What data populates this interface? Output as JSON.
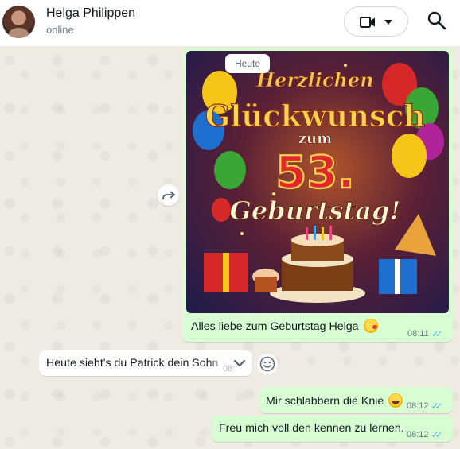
{
  "header": {
    "contact_name": "Helga Philippen",
    "status": "online"
  },
  "chat": {
    "date_chip": "Heute",
    "image_message": {
      "image_text_lines": [
        "Herzlichen",
        "Glückwunsch",
        "zum",
        "53.",
        "Geburtstag!"
      ],
      "caption": "Alles liebe zum Geburtstag Helga",
      "caption_emoji": "face-blowing-kiss",
      "time": "08:11",
      "status": "read"
    },
    "incoming_message": {
      "text": "Heute sieht's du Patrick dein Sohn",
      "time": "08:"
    },
    "outgoing_messages": [
      {
        "text": "Mir schlabbern die Knie",
        "emoji": "face-with-tears-of-joy",
        "time": "08:12",
        "status": "read"
      },
      {
        "text": "Freu mich voll den kennen zu lernen.",
        "time": "08:12",
        "status": "read"
      }
    ]
  },
  "icons": {
    "video": "video-call-icon",
    "dropdown": "caret-down-icon",
    "search": "search-icon",
    "forward": "forward-icon",
    "menu": "chevron-down-icon",
    "react": "emoji-react-icon",
    "read": "double-check-icon"
  },
  "colors": {
    "chat_bg": "#efeae2",
    "outgoing_bubble": "#d9fdd3",
    "incoming_bubble": "#ffffff",
    "read_ticks": "#53bdeb",
    "secondary_text": "#667781"
  }
}
